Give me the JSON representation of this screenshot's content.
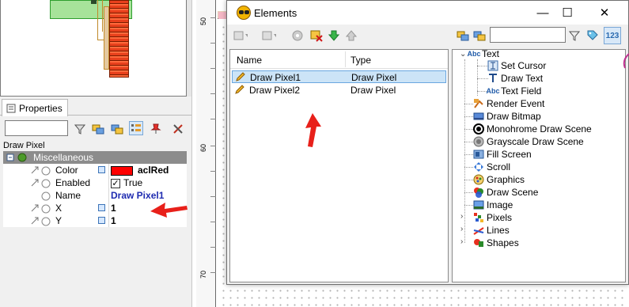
{
  "properties_panel": {
    "tab_label": "Properties",
    "selected_object": "Draw Pixel",
    "category": "Miscellaneous",
    "rows": [
      {
        "name": "Color",
        "value": "aclRed",
        "has_button": true
      },
      {
        "name": "Enabled",
        "value": "True",
        "has_button": false
      },
      {
        "name": "Name",
        "value": "Draw Pixel1",
        "has_button": false
      },
      {
        "name": "X",
        "value": "1",
        "has_button": true
      },
      {
        "name": "Y",
        "value": "1",
        "has_button": true
      }
    ],
    "toolbar_icons": [
      "filter-icon",
      "expand-all-icon",
      "collapse-all-icon",
      "categorized-icon",
      "pin-icon",
      "tools-icon"
    ]
  },
  "ruler": {
    "labels": [
      "50",
      "60",
      "70"
    ]
  },
  "elements_window": {
    "title": "Elements",
    "controls": {
      "minimize": "—",
      "maximize": "☐",
      "close": "✕"
    },
    "list": {
      "columns": [
        "Name",
        "Type"
      ],
      "rows": [
        {
          "name": "Draw Pixel1",
          "type": "Draw Pixel",
          "selected": true
        },
        {
          "name": "Draw Pixel2",
          "type": "Draw Pixel",
          "selected": false
        }
      ]
    },
    "tree": {
      "text_group": "Text",
      "text_children": [
        "Set Cursor",
        "Draw Text",
        "Text Field"
      ],
      "items": [
        "Render Event",
        "Draw Bitmap",
        "Monohrome Draw Scene",
        "Grayscale Draw Scene",
        "Fill Screen",
        "Scroll",
        "Graphics",
        "Draw Scene",
        "Image"
      ],
      "collapsed_groups": [
        "Pixels",
        "Lines",
        "Shapes"
      ]
    }
  },
  "colors": {
    "accent_red": "#ff0000",
    "arrow_red": "#e8201a",
    "selection": "#cce4f7"
  }
}
